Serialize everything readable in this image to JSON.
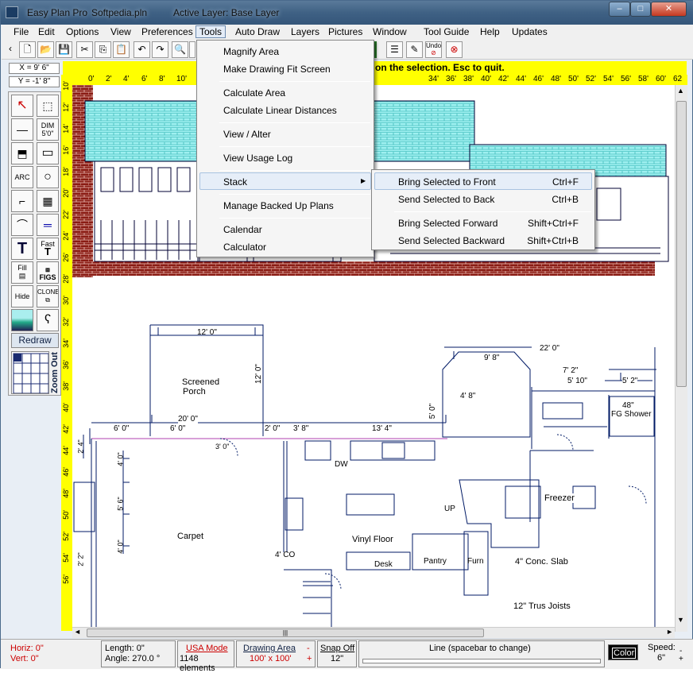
{
  "window": {
    "app_name": "Easy Plan Pro",
    "file_name": "Softpedia.pln",
    "active_layer": "Active Layer: Base Layer",
    "minimize_label": "–",
    "maximize_label": "□",
    "close_label": "✕"
  },
  "menu": [
    "File",
    "Edit",
    "Options",
    "View",
    "Preferences",
    "Tools",
    "Auto Draw",
    "Layers",
    "Pictures",
    "Window",
    "Tool Guide",
    "Help",
    "Updates"
  ],
  "toolbar": {
    "undo_label": "Undo",
    "prompt": "on the selection.  Esc to quit."
  },
  "coords": {
    "x": "X = 9' 6\"",
    "y": "Y = -1' 8\""
  },
  "ruler_top": [
    "0'",
    "2'",
    "4'",
    "6'",
    "8'",
    "10'",
    "34'",
    "36'",
    "38'",
    "40'",
    "42'",
    "44'",
    "46'",
    "48'",
    "50'",
    "52'",
    "54'",
    "56'",
    "58'",
    "60'",
    "62"
  ],
  "ruler_left": [
    "10'",
    "12'",
    "14'",
    "16'",
    "18'",
    "20'",
    "22'",
    "24'",
    "26'",
    "28'",
    "30'",
    "32'",
    "34'",
    "36'",
    "38'",
    "40'",
    "42'",
    "44'",
    "46'",
    "48'",
    "50'",
    "52'",
    "54'",
    "56'"
  ],
  "palette": {
    "dim_label": "DIM",
    "dim_sub": "5'0\"",
    "arc_label": "ARC",
    "fast_label": "Fast",
    "fill_label": "Fill",
    "figs_label": "FIGS",
    "hide_label": "Hide",
    "clone_label": "CLONE",
    "redraw_label": "Redraw",
    "zoom_label": "Zoom Out"
  },
  "tools_menu": {
    "items": [
      {
        "label": "Magnify Area"
      },
      {
        "label": "Make Drawing Fit Screen"
      },
      {
        "label": "Calculate Area"
      },
      {
        "label": "Calculate Linear Distances"
      },
      {
        "label": "View / Alter"
      },
      {
        "label": "View Usage Log"
      },
      {
        "label": "Stack"
      },
      {
        "label": "Manage Backed Up Plans"
      },
      {
        "label": "Calendar"
      },
      {
        "label": "Calculator"
      }
    ]
  },
  "stack_submenu": {
    "items": [
      {
        "label": "Bring Selected to Front",
        "shortcut": "Ctrl+F"
      },
      {
        "label": "Send Selected to Back",
        "shortcut": "Ctrl+B"
      },
      {
        "label": "Bring  Selected Forward",
        "shortcut": "Shift+Ctrl+F"
      },
      {
        "label": "Send Selected Backward",
        "shortcut": "Shift+Ctrl+B"
      }
    ]
  },
  "plan": {
    "labels": {
      "dim_12": "12' 0\"",
      "screened": "Screened",
      "porch": "Porch",
      "dim_12v": "12' 0\"",
      "dim_20": "20' 0\"",
      "dim_6a": "6' 0\"",
      "dim_6b": "6' 0\"",
      "dim_2": "2' 0\"",
      "dim_3_8": "3' 8\"",
      "dim_13_4": "13' 4\"",
      "dim_5": "5' 0\"",
      "dim_9_8": "9' 8\"",
      "dim_4_8": "4' 8\"",
      "dim_22": "22' 0\"",
      "dim_7_2": "7' 2\"",
      "dim_5_10": "5' 10\"",
      "dim_5_2": "5' 2\"",
      "shower_dim": "48\"",
      "shower": "FG Shower",
      "dw": "DW",
      "carpet": "Carpet",
      "vinyl": "Vinyl Floor",
      "up": "UP",
      "freezer": "Freezer",
      "desk": "Desk",
      "pantry": "Pantry",
      "furn": "Furn",
      "slab": "4\" Conc. Slab",
      "joists": "12\" Trus Joists",
      "co": "4' CO",
      "dim_3_0": "3' 0\"",
      "dim_2_4": "2' 4\"",
      "dim_4_0a": "4' 0\"",
      "dim_5_6": "5' 6\"",
      "dim_4_0b": "4' 0\"",
      "dim_2_2": "2' 2\""
    }
  },
  "status": {
    "horiz": "Horiz: 0\"",
    "vert": "Vert:  0\"",
    "length": "Length:  0\"",
    "angle": "Angle:  270.0 °",
    "usa_mode": "USA Mode",
    "elements": "1148 elements",
    "drawing_area": "Drawing Area",
    "drawing_area_val": "100' x 100'",
    "snap_off": "Snap Off",
    "snap_val": "12\"",
    "line_mode": "Line  (spacebar to change)",
    "color": "Color",
    "speed": "Speed:",
    "speed_val": "6\"",
    "minus": "-",
    "plus": "+",
    "hscroll_grip": "|||"
  }
}
